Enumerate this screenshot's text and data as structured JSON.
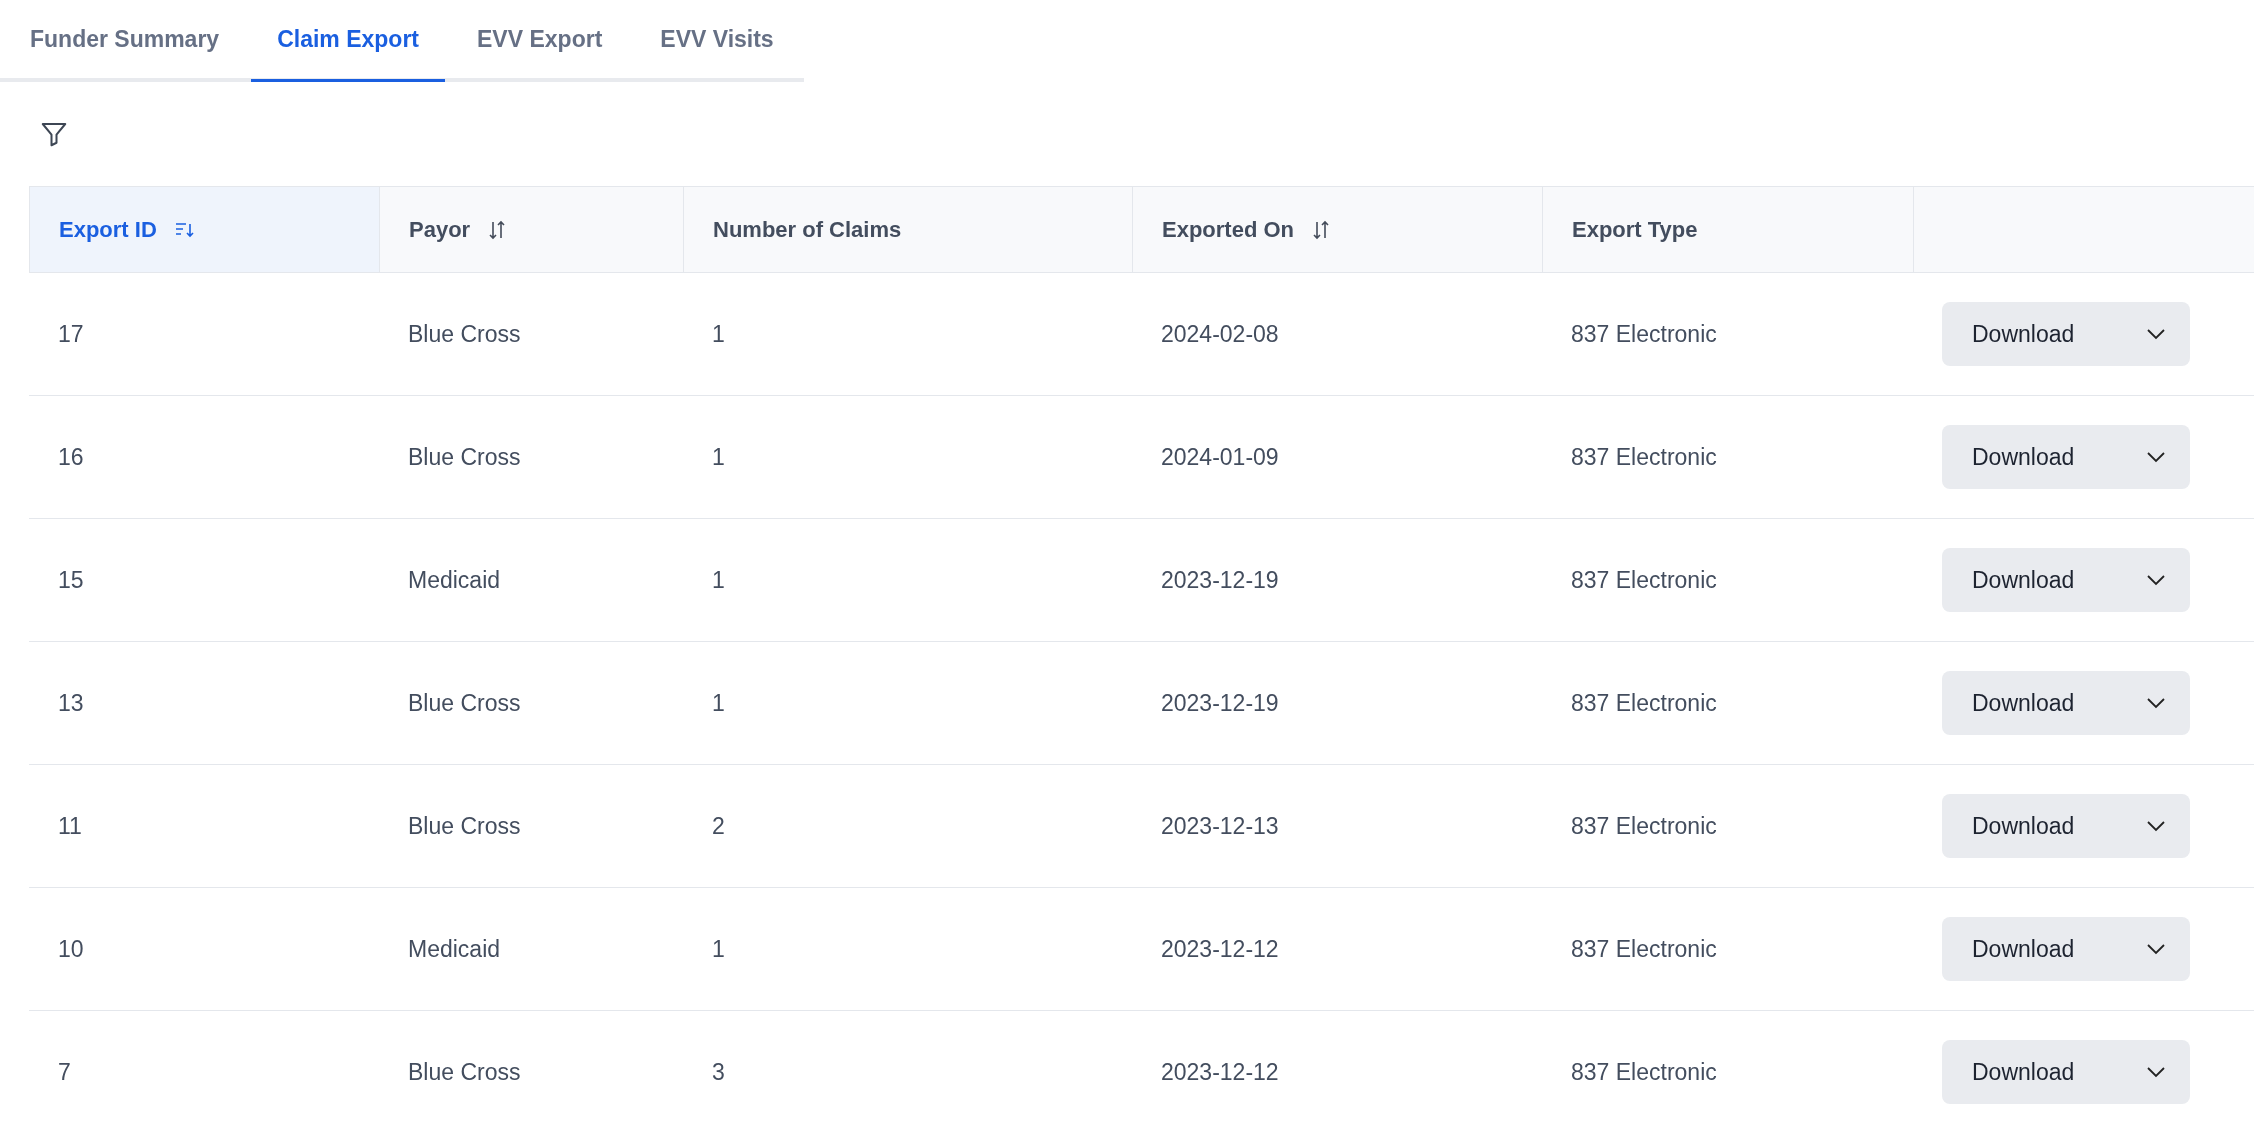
{
  "tabs": [
    {
      "label": "Funder Summary",
      "selected": false
    },
    {
      "label": "Claim Export",
      "selected": true
    },
    {
      "label": "EVV Export",
      "selected": false
    },
    {
      "label": "EVV Visits",
      "selected": false
    }
  ],
  "table": {
    "columns": [
      {
        "label": "Export ID",
        "sortable": true,
        "selected": true
      },
      {
        "label": "Payor",
        "sortable": true,
        "selected": false
      },
      {
        "label": "Number of Claims",
        "sortable": false,
        "selected": false
      },
      {
        "label": "Exported On",
        "sortable": true,
        "selected": false
      },
      {
        "label": "Export Type",
        "sortable": false,
        "selected": false
      }
    ],
    "rows": [
      {
        "cells": [
          "17",
          "Blue Cross",
          "1",
          "2024-02-08",
          "837 Electronic"
        ],
        "action": "Download"
      },
      {
        "cells": [
          "16",
          "Blue Cross",
          "1",
          "2024-01-09",
          "837 Electronic"
        ],
        "action": "Download"
      },
      {
        "cells": [
          "15",
          "Medicaid",
          "1",
          "2023-12-19",
          "837 Electronic"
        ],
        "action": "Download"
      },
      {
        "cells": [
          "13",
          "Blue Cross",
          "1",
          "2023-12-19",
          "837 Electronic"
        ],
        "action": "Download"
      },
      {
        "cells": [
          "11",
          "Blue Cross",
          "2",
          "2023-12-13",
          "837 Electronic"
        ],
        "action": "Download"
      },
      {
        "cells": [
          "10",
          "Medicaid",
          "1",
          "2023-12-12",
          "837 Electronic"
        ],
        "action": "Download"
      },
      {
        "cells": [
          "7",
          "Blue Cross",
          "3",
          "2023-12-12",
          "837 Electronic"
        ],
        "action": "Download"
      }
    ]
  }
}
